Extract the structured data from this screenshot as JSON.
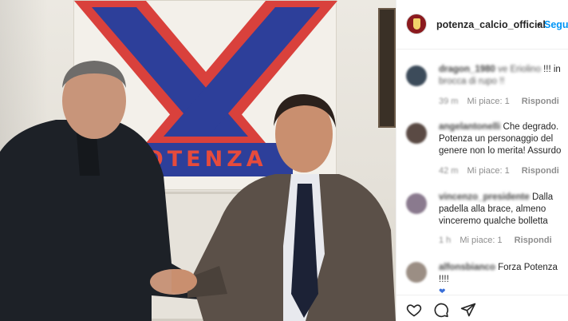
{
  "photo": {
    "banner_word": "POTENZA",
    "colors": {
      "banner_red": "#d9413c",
      "banner_blue": "#2d3f9a"
    }
  },
  "header": {
    "account_name": "potenza_calcio_official",
    "separator": "•",
    "follow_label": "Segu"
  },
  "comments": [
    {
      "username": "dragon_1980",
      "text_visible": "!!! in",
      "text_blurred_a": "ve Eriolino",
      "text_blurred_b": "brocca di rupo !!",
      "time": "39 m",
      "likes": "Mi piace: 1",
      "reply": "Rispondi",
      "avatar_icon": "user-avatar-icon"
    },
    {
      "username": "angelantonelli",
      "text_visible": "Che degrado. Potenza un personaggio del genere non lo merita! Assurdo",
      "time": "42 m",
      "likes": "Mi piace: 1",
      "reply": "Rispondi",
      "avatar_icon": "user-avatar-icon"
    },
    {
      "username": "vincenzo_presidente",
      "text_visible": "Dalla padella alla brace, almeno vinceremo qualche bolletta",
      "time": "1 h",
      "likes": "Mi piace: 1",
      "reply": "Rispondi",
      "avatar_icon": "user-avatar-icon"
    },
    {
      "username": "alfonsbianco",
      "text_visible": "Forza Potenza !!!!",
      "heart_glyph": "❤",
      "avatar_icon": "user-avatar-icon"
    }
  ],
  "actions": [
    {
      "name": "like",
      "icon": "heart-icon"
    },
    {
      "name": "comment",
      "icon": "comment-icon"
    },
    {
      "name": "share",
      "icon": "share-icon"
    }
  ],
  "colors": {
    "link_blue": "#0095f6",
    "text": "#262626",
    "meta": "#8e8e8e"
  }
}
